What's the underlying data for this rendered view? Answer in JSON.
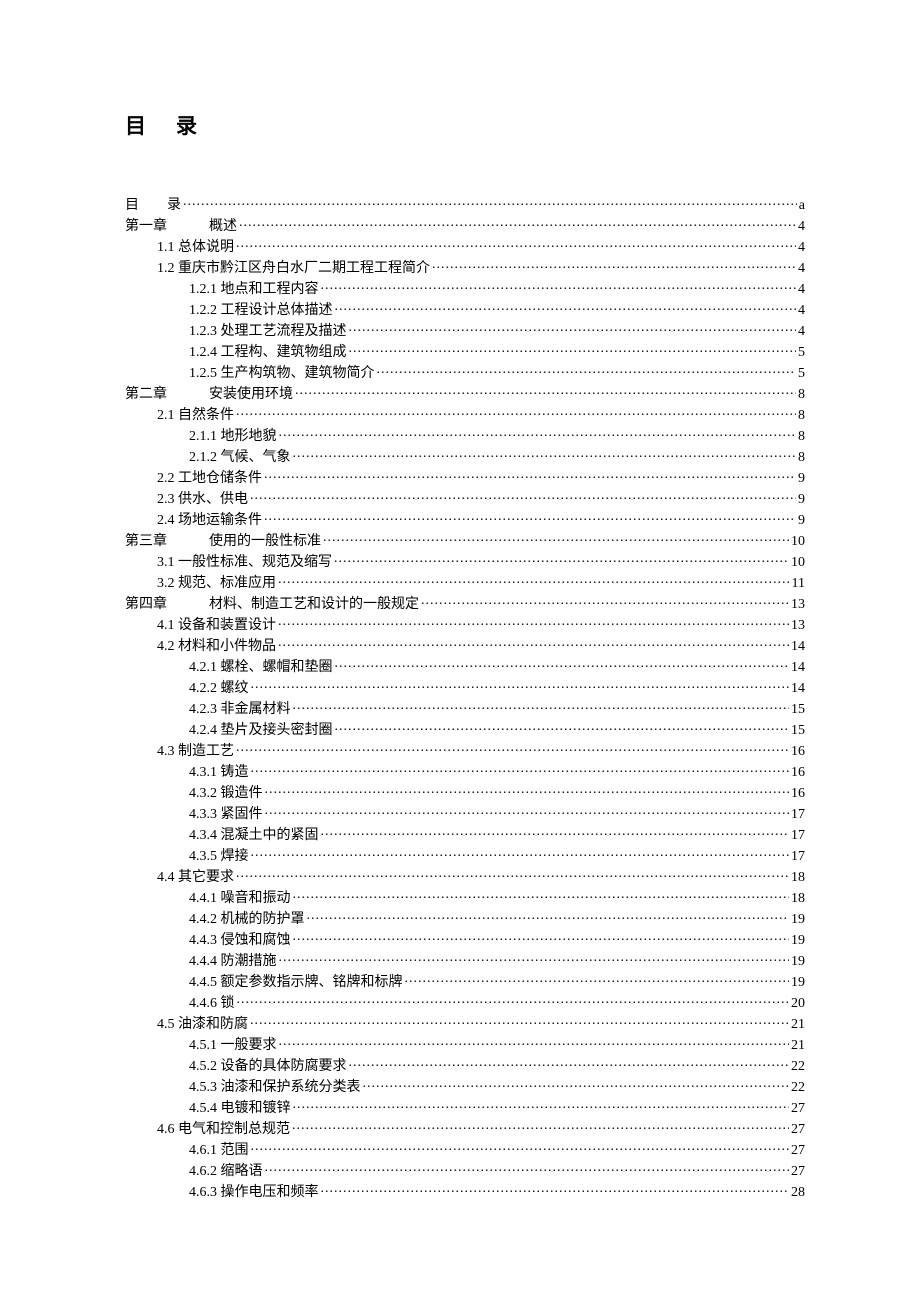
{
  "title_part1": "目",
  "title_part2": "录",
  "toc": [
    {
      "indent": 0,
      "label": "目　　录",
      "page": "a",
      "special": "firstrow"
    },
    {
      "indent": 0,
      "label": "第一章　　　概述",
      "page": "4",
      "special": "chapter"
    },
    {
      "indent": 1,
      "label": "1.1  总体说明",
      "page": "4"
    },
    {
      "indent": 1,
      "label": "1.2 重庆市黔江区舟白水厂二期工程工程简介",
      "page": "4"
    },
    {
      "indent": 2,
      "label": "1.2.1  地点和工程内容",
      "page": "4"
    },
    {
      "indent": 2,
      "label": "1.2.2  工程设计总体描述",
      "page": "4"
    },
    {
      "indent": 2,
      "label": "1.2.3  处理工艺流程及描述",
      "page": "4"
    },
    {
      "indent": 2,
      "label": "1.2.4  工程构、建筑物组成",
      "page": "5"
    },
    {
      "indent": 2,
      "label": "1.2.5  生产构筑物、建筑物简介",
      "page": "5"
    },
    {
      "indent": 0,
      "label": "第二章　　　安装使用环境",
      "page": "8",
      "special": "chapter"
    },
    {
      "indent": 1,
      "label": "2.1 自然条件",
      "page": "8"
    },
    {
      "indent": 2,
      "label": "2.1.1 地形地貌",
      "page": "8"
    },
    {
      "indent": 2,
      "label": "2.1.2  气候、气象",
      "page": "8"
    },
    {
      "indent": 1,
      "label": "2.2 工地仓储条件",
      "page": "9"
    },
    {
      "indent": 1,
      "label": "2.3 供水、供电",
      "page": "9"
    },
    {
      "indent": 1,
      "label": "2.4 场地运输条件",
      "page": "9"
    },
    {
      "indent": 0,
      "label": "第三章　　　使用的一般性标准",
      "page": "10",
      "special": "chapter"
    },
    {
      "indent": 1,
      "label": "3.1 一般性标准、规范及缩写",
      "page": "10"
    },
    {
      "indent": 1,
      "label": "3.2 规范、标准应用",
      "page": "11"
    },
    {
      "indent": 0,
      "label": "第四章　　　材料、制造工艺和设计的一般规定",
      "page": "13",
      "special": "chapter"
    },
    {
      "indent": 1,
      "label": "4.1 设备和装置设计",
      "page": "13"
    },
    {
      "indent": 1,
      "label": "4.2 材料和小件物品",
      "page": "14"
    },
    {
      "indent": 2,
      "label": "4.2.1 螺栓、螺帽和垫圈",
      "page": "14"
    },
    {
      "indent": 2,
      "label": "4.2.2 螺纹",
      "page": "14"
    },
    {
      "indent": 2,
      "label": "4.2.3  非金属材料",
      "page": "15"
    },
    {
      "indent": 2,
      "label": "4.2.4 垫片及接头密封圈",
      "page": "15"
    },
    {
      "indent": 1,
      "label": "4.3 制造工艺",
      "page": "16"
    },
    {
      "indent": 2,
      "label": "4.3.1 铸造",
      "page": "16"
    },
    {
      "indent": 2,
      "label": "4.3.2 锻造件",
      "page": "16"
    },
    {
      "indent": 2,
      "label": "4.3.3 紧固件",
      "page": "17"
    },
    {
      "indent": 2,
      "label": "4.3.4 混凝土中的紧固",
      "page": "17"
    },
    {
      "indent": 2,
      "label": "4.3.5 焊接",
      "page": "17"
    },
    {
      "indent": 1,
      "label": "4.4 其它要求",
      "page": "18"
    },
    {
      "indent": 2,
      "label": "4.4.1 噪音和振动",
      "page": "18"
    },
    {
      "indent": 2,
      "label": "4.4.2 机械的防护罩",
      "page": "19"
    },
    {
      "indent": 2,
      "label": "4.4.3 侵蚀和腐蚀",
      "page": "19"
    },
    {
      "indent": 2,
      "label": "4.4.4 防潮措施",
      "page": "19"
    },
    {
      "indent": 2,
      "label": "4.4.5 额定参数指示牌、铭牌和标牌",
      "page": "19"
    },
    {
      "indent": 2,
      "label": "4.4.6 锁",
      "page": "20"
    },
    {
      "indent": 1,
      "label": "4.5  油漆和防腐",
      "page": "21"
    },
    {
      "indent": 2,
      "label": "4.5.1 一般要求",
      "page": "21"
    },
    {
      "indent": 2,
      "label": "4.5.2 设备的具体防腐要求",
      "page": "22"
    },
    {
      "indent": 2,
      "label": "4.5.3 油漆和保护系统分类表",
      "page": "22"
    },
    {
      "indent": 2,
      "label": "4.5.4 电镀和镀锌",
      "page": "27"
    },
    {
      "indent": 1,
      "label": "4.6 电气和控制总规范",
      "page": "27"
    },
    {
      "indent": 2,
      "label": "4.6.1 范围",
      "page": "27"
    },
    {
      "indent": 2,
      "label": "4.6.2 缩略语",
      "page": "27"
    },
    {
      "indent": 2,
      "label": "4.6.3 操作电压和频率",
      "page": "28"
    }
  ]
}
